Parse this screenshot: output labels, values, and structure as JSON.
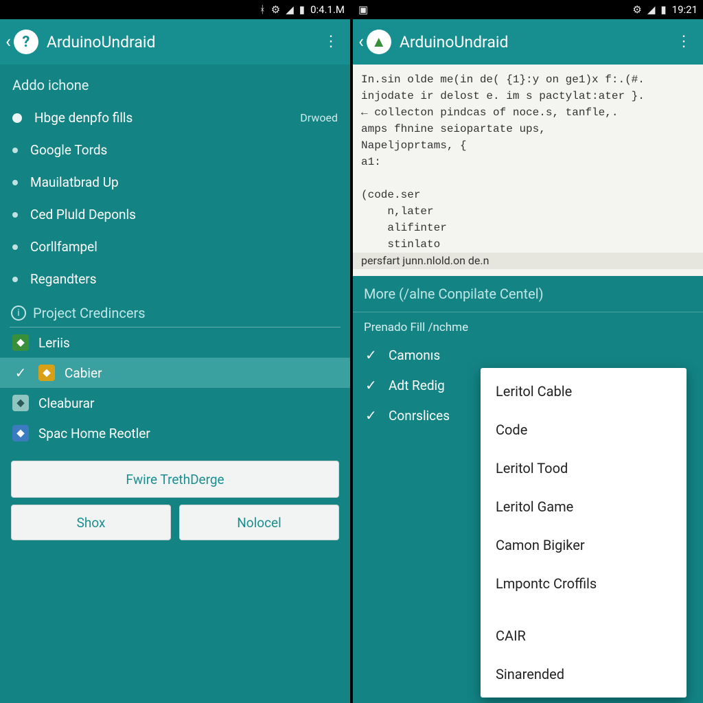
{
  "left": {
    "status": {
      "time": "0:4.1.M"
    },
    "appbar": {
      "title": "ArduinoUndraid",
      "logoGlyph": "?"
    },
    "sectionTitle": "Addo ichone",
    "items": [
      {
        "label": "Hbge denpfo fills",
        "tail": "Drwoed",
        "dot": "big"
      },
      {
        "label": "Google Tords",
        "dot": "small"
      },
      {
        "label": "Mauilatbrad Up",
        "dot": "small"
      },
      {
        "label": "Ced Pluld Deponls",
        "dot": "small"
      },
      {
        "label": "Corllfampel",
        "dot": "small"
      },
      {
        "label": "Regandters",
        "dot": "small"
      }
    ],
    "subhead": "Project Credincers",
    "files": [
      {
        "label": "Leriis",
        "icon": "green"
      },
      {
        "label": "Cabier",
        "icon": "yellow",
        "checked": true,
        "selected": true
      },
      {
        "label": "Cleaburar",
        "icon": "teal"
      },
      {
        "label": "Spac Home Reotler",
        "icon": "pc"
      }
    ],
    "buttons": {
      "wide": "Fwire TrethDerge",
      "left": "Shox",
      "right": "Nolocel"
    }
  },
  "right": {
    "status": {
      "time": "19:21"
    },
    "appbar": {
      "title": "ArduinoUndraid",
      "logoGlyph": "▲"
    },
    "codeLines": [
      "In.sin olde me(in de( {1}:y on ge1)x f:.(#.",
      "injodate ir delost e. im s pactylat:ater }.",
      "← collecton pindcas of noce.s, tanfle,.",
      "amps fhnine seiopartate ups,",
      "Napeljoprtams, {",
      "a1:",
      "",
      "(code.ser",
      "    n,later",
      "    alifinter",
      "    stinlato"
    ],
    "codeHighlighted": "persfart junn.nlold.on de.n",
    "panelHead": "More (/alne Conpilate Centel)",
    "panelSub": "Prenado Fill /nchme",
    "checks": [
      {
        "label": "Camonıs"
      },
      {
        "label": "Adt Redig"
      },
      {
        "label": "Conrslices"
      }
    ],
    "popup": {
      "items": [
        "Leritol Cable",
        "Code",
        "Leritol Tood",
        "Leritol Game",
        "Camon Bigiker",
        "Lmpontc Croffils"
      ],
      "secondary": [
        "CAIR",
        "Sinarended"
      ]
    }
  }
}
